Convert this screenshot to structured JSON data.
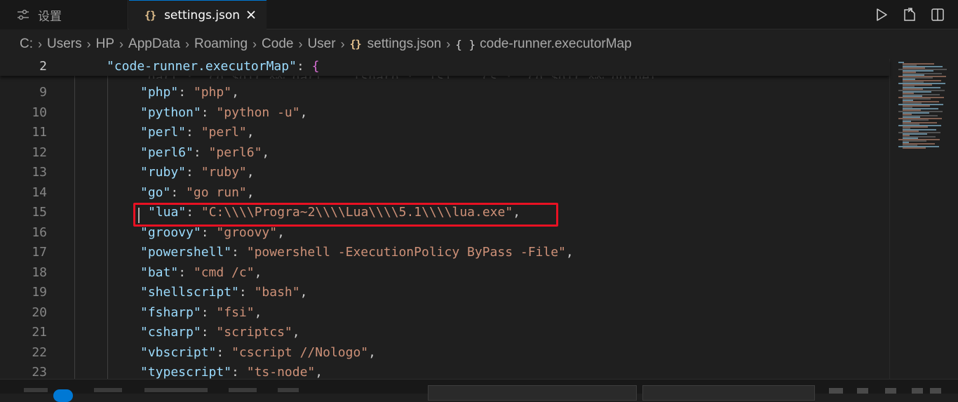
{
  "tabs": {
    "settings_ui": {
      "label": "设置",
      "icon": "settings-sliders-icon"
    },
    "settings_json": {
      "label": "settings.json",
      "icon": "json-braces-icon",
      "braces": "{}"
    }
  },
  "breadcrumb": {
    "segments": [
      "C:",
      "Users",
      "HP",
      "AppData",
      "Roaming",
      "Code",
      "User",
      "settings.json",
      "code-runner.executorMap"
    ],
    "file_icon": "{}",
    "symbol_icon": "{ }"
  },
  "editor": {
    "sticky": {
      "number": "2",
      "key": "\"code-runner.executorMap\"",
      "colon": ": ",
      "brace": "{"
    },
    "partial_line": "\"dart\": \"cd $dir && dart\", \"fsharp\": \"fsi\", \"cs\": \"cd $dir && dotnet\"",
    "lines": [
      {
        "number": "9",
        "key": "\"php\"",
        "value": "\"php\""
      },
      {
        "number": "10",
        "key": "\"python\"",
        "value": "\"python -u\""
      },
      {
        "number": "11",
        "key": "\"perl\"",
        "value": "\"perl\""
      },
      {
        "number": "12",
        "key": "\"perl6\"",
        "value": "\"perl6\""
      },
      {
        "number": "13",
        "key": "\"ruby\"",
        "value": "\"ruby\""
      },
      {
        "number": "14",
        "key": "\"go\"",
        "value": "\"go run\""
      },
      {
        "number": "15",
        "key": "\"lua\"",
        "value": "\"C:\\\\\\\\Progra~2\\\\\\\\Lua\\\\\\\\5.1\\\\\\\\lua.exe\""
      },
      {
        "number": "16",
        "key": "\"groovy\"",
        "value": "\"groovy\""
      },
      {
        "number": "17",
        "key": "\"powershell\"",
        "value": "\"powershell -ExecutionPolicy ByPass -File\""
      },
      {
        "number": "18",
        "key": "\"bat\"",
        "value": "\"cmd /c\""
      },
      {
        "number": "19",
        "key": "\"shellscript\"",
        "value": "\"bash\""
      },
      {
        "number": "20",
        "key": "\"fsharp\"",
        "value": "\"fsi\""
      },
      {
        "number": "21",
        "key": "\"csharp\"",
        "value": "\"scriptcs\""
      },
      {
        "number": "22",
        "key": "\"vbscript\"",
        "value": "\"cscript //Nologo\""
      },
      {
        "number": "23",
        "key": "\"typescript\"",
        "value": "\"ts-node\""
      }
    ],
    "highlighted_line": "15"
  },
  "colors": {
    "key": "#9cdcfe",
    "string": "#ce9178",
    "brace": "#da70d6",
    "annotation_box": "#e81123",
    "accent": "#0078d4"
  },
  "actions": [
    "run-icon",
    "open-settings-json-icon",
    "split-editor-icon"
  ]
}
